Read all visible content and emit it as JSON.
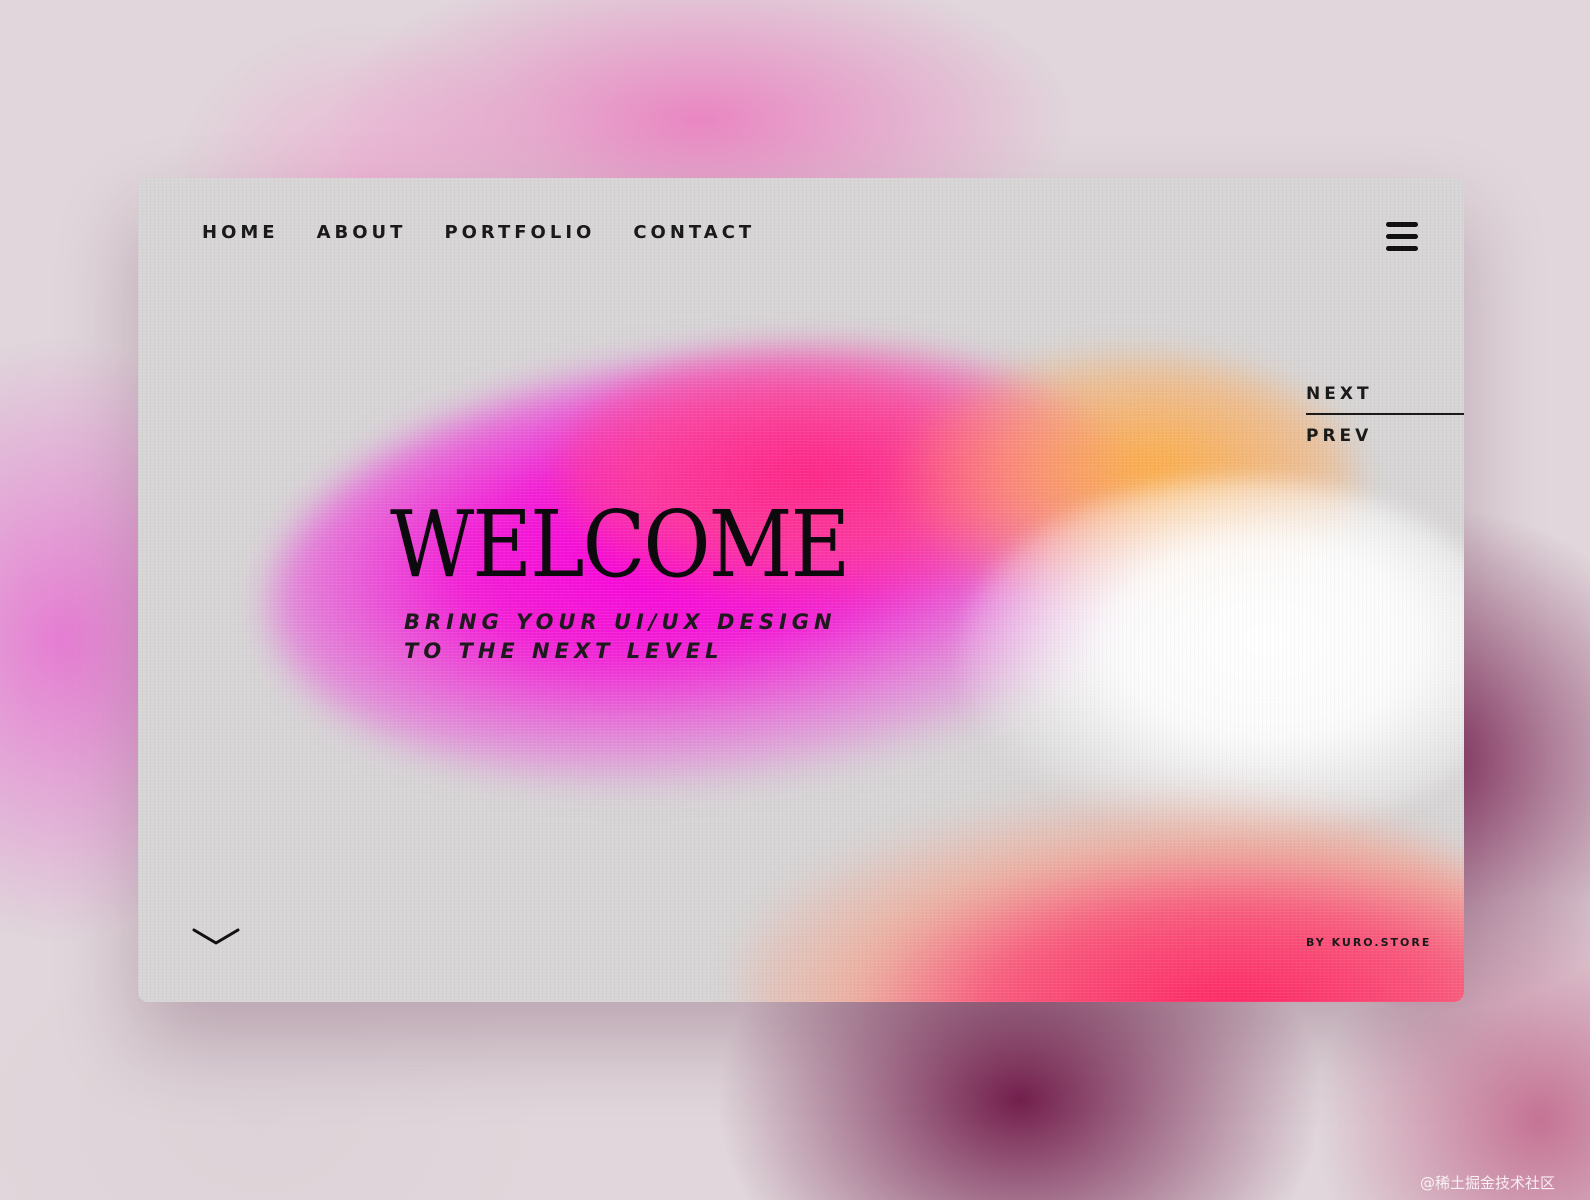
{
  "nav": {
    "items": [
      {
        "label": "HOME"
      },
      {
        "label": "ABOUT"
      },
      {
        "label": "PORTFOLIO"
      },
      {
        "label": "CONTACT"
      }
    ]
  },
  "menu": {
    "icon": "hamburger-menu-icon"
  },
  "pager": {
    "next_label": "NEXT",
    "prev_label": "PREV"
  },
  "hero": {
    "title": "WELCOME",
    "subtitle_line1": "BRING YOUR UI/UX DESIGN",
    "subtitle_line2": "TO THE NEXT LEVEL"
  },
  "footer": {
    "scroll_icon": "chevron-down-icon",
    "credit": "BY KURO.STORE"
  },
  "watermark": "@稀土掘金技术社区",
  "colors": {
    "magenta": "#F700DC",
    "hot_pink": "#FF2A82",
    "orange": "#FFAA3C",
    "card_bg": "#D7D5D6",
    "text": "#1A1A1A"
  }
}
